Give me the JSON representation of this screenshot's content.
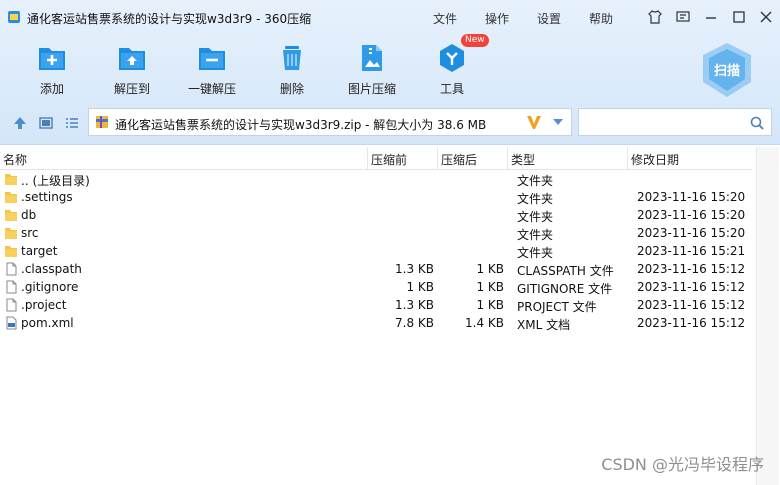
{
  "window": {
    "title": "通化客运站售票系统的设计与实现w3d3r9 - 360压缩"
  },
  "menu": {
    "file": "文件",
    "operate": "操作",
    "settings": "设置",
    "help": "帮助"
  },
  "toolbar": {
    "add": "添加",
    "extract_to": "解压到",
    "one_click_extract": "一键解压",
    "delete": "删除",
    "image_compress": "图片压缩",
    "tools": "工具",
    "new_badge": "New",
    "scan": "扫描"
  },
  "address": {
    "path": "通化客运站售票系统的设计与实现w3d3r9.zip - 解包大小为 38.6 MB"
  },
  "search": {
    "placeholder": ""
  },
  "columns": {
    "name": "名称",
    "compressed_before": "压缩前",
    "compressed_after": "压缩后",
    "type": "类型",
    "modified": "修改日期"
  },
  "files": [
    {
      "name": ".. (上级目录)",
      "before": "",
      "after": "",
      "type": "文件夹",
      "date": "",
      "kind": "folder"
    },
    {
      "name": ".settings",
      "before": "",
      "after": "",
      "type": "文件夹",
      "date": "2023-11-16 15:20",
      "kind": "folder"
    },
    {
      "name": "db",
      "before": "",
      "after": "",
      "type": "文件夹",
      "date": "2023-11-16 15:20",
      "kind": "folder"
    },
    {
      "name": "src",
      "before": "",
      "after": "",
      "type": "文件夹",
      "date": "2023-11-16 15:20",
      "kind": "folder"
    },
    {
      "name": "target",
      "before": "",
      "after": "",
      "type": "文件夹",
      "date": "2023-11-16 15:21",
      "kind": "folder"
    },
    {
      "name": ".classpath",
      "before": "1.3 KB",
      "after": "1 KB",
      "type": "CLASSPATH 文件",
      "date": "2023-11-16 15:12",
      "kind": "file"
    },
    {
      "name": ".gitignore",
      "before": "1 KB",
      "after": "1 KB",
      "type": "GITIGNORE 文件",
      "date": "2023-11-16 15:12",
      "kind": "file"
    },
    {
      "name": ".project",
      "before": "1.3 KB",
      "after": "1 KB",
      "type": "PROJECT 文件",
      "date": "2023-11-16 15:12",
      "kind": "file"
    },
    {
      "name": "pom.xml",
      "before": "7.8 KB",
      "after": "1.4 KB",
      "type": "XML 文档",
      "date": "2023-11-16 15:12",
      "kind": "xml"
    }
  ],
  "watermark": "CSDN @光冯毕设程序",
  "colors": {
    "accent": "#1f8ee0",
    "folder": "#f6c343",
    "band": "#dcebfa"
  }
}
